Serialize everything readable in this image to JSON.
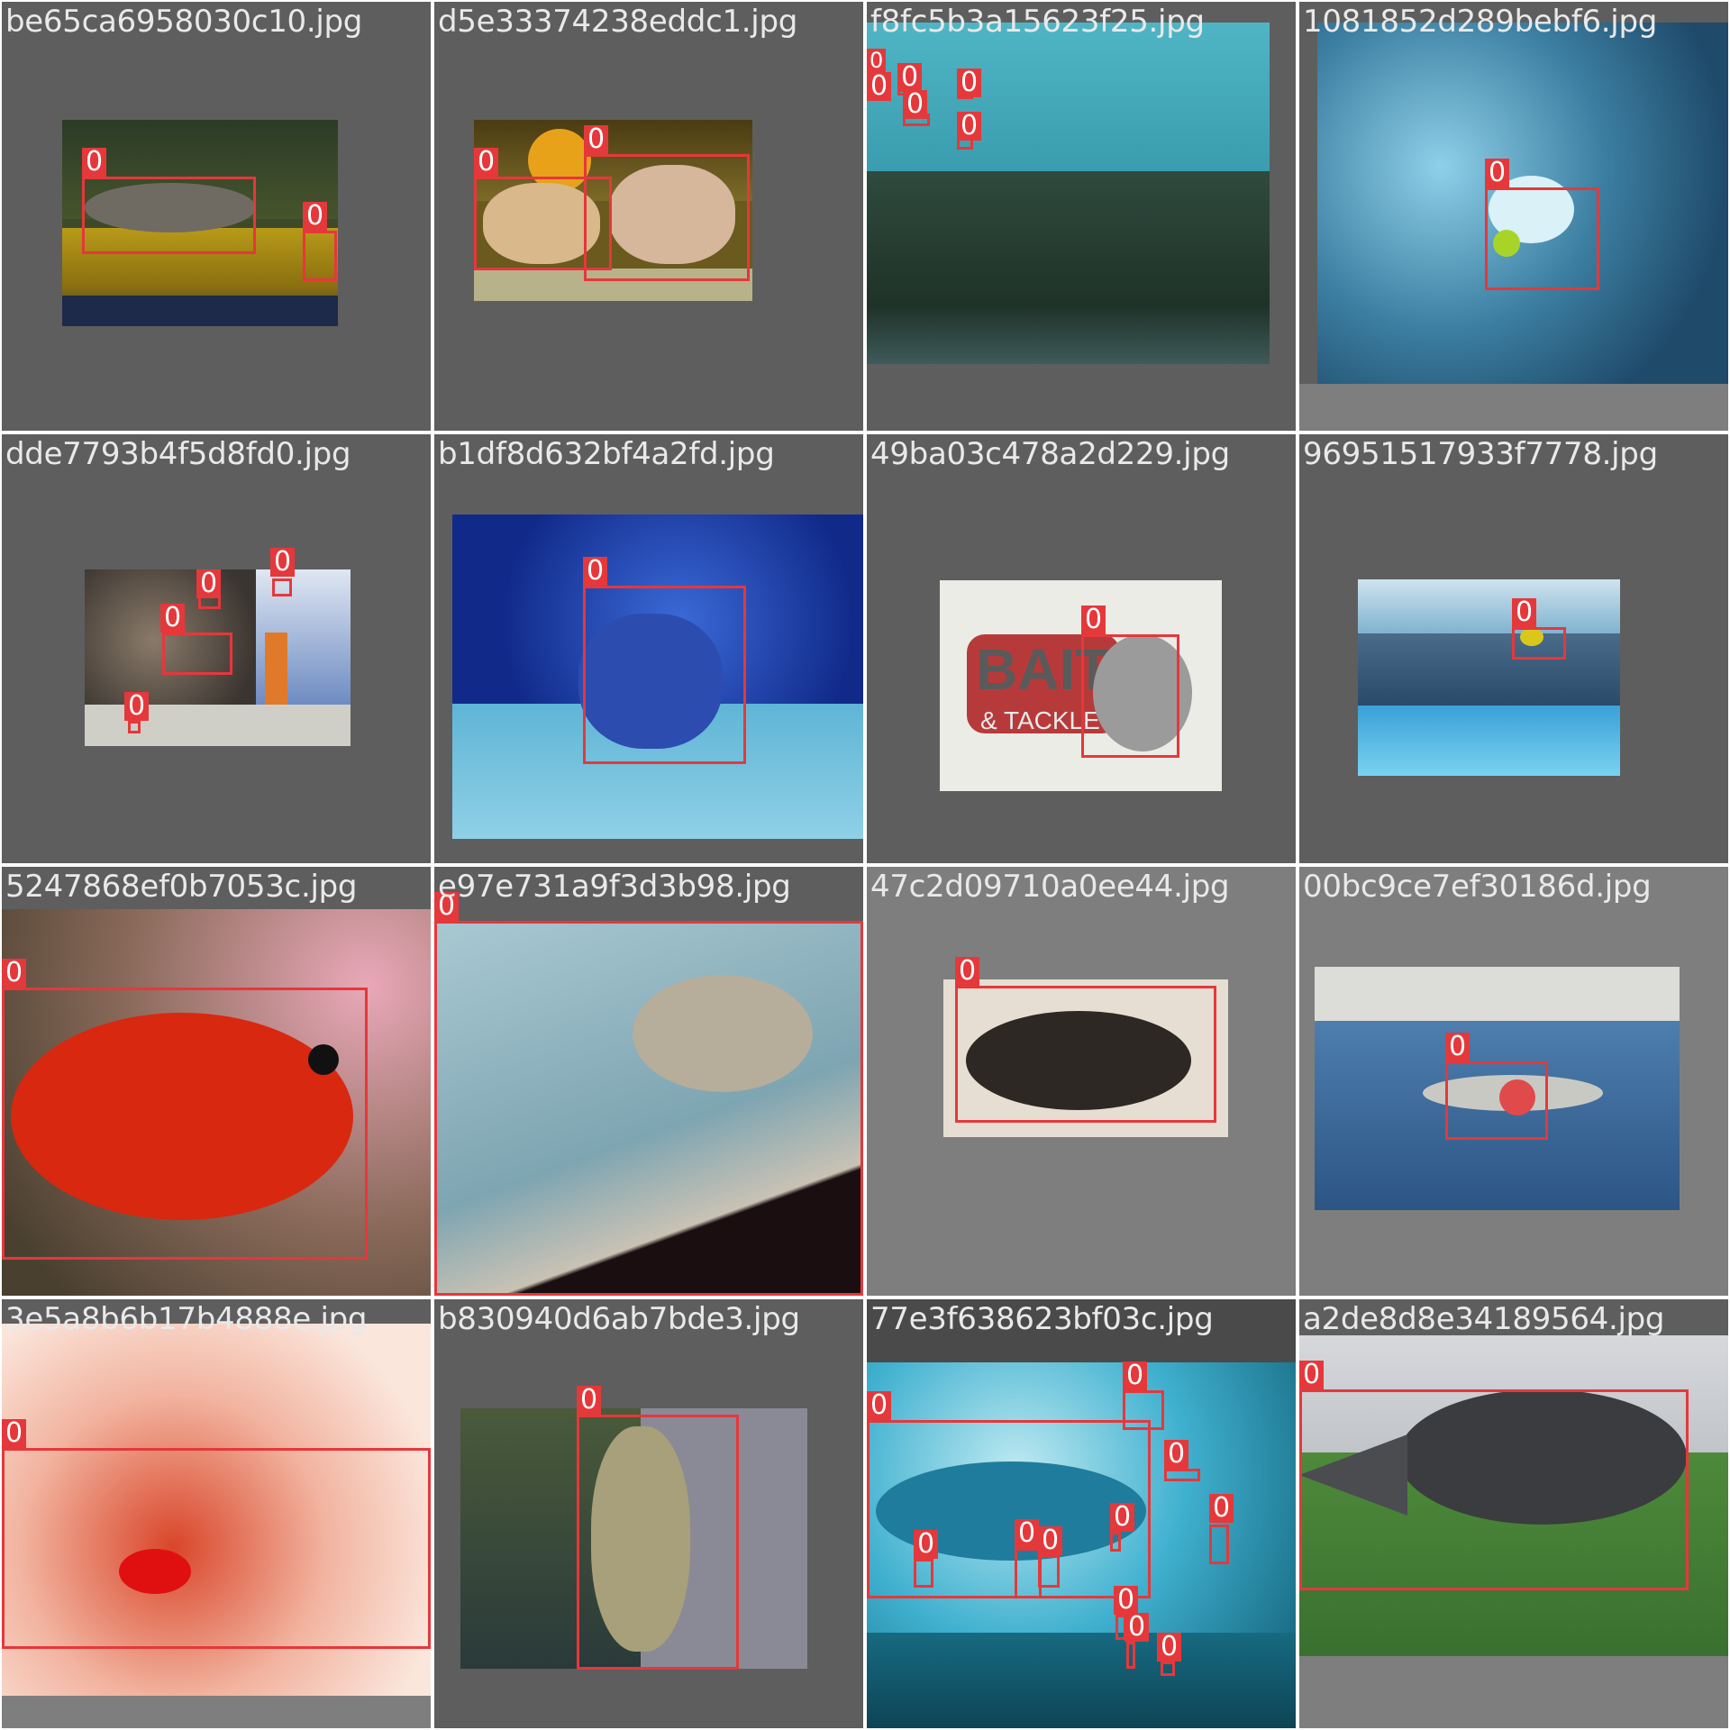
{
  "mosaic": {
    "tiles": [
      {
        "filename": "be65ca6958030c10.jpg",
        "labels": [
          "0",
          "0"
        ]
      },
      {
        "filename": "d5e33374238eddc1.jpg",
        "labels": [
          "0",
          "0"
        ]
      },
      {
        "filename": "f8fc5b3a15623f25.jpg",
        "labels": [
          "0",
          "0",
          "0",
          "0",
          "0",
          "0"
        ]
      },
      {
        "filename": "1081852d289bebf6.jpg",
        "labels": [
          "0"
        ]
      },
      {
        "filename": "dde7793b4f5d8fd0.jpg",
        "labels": [
          "0",
          "0",
          "0",
          "0"
        ]
      },
      {
        "filename": "b1df8d632bf4a2fd.jpg",
        "labels": [
          "0"
        ]
      },
      {
        "filename": "49ba03c478a2d229.jpg",
        "labels": [
          "0"
        ],
        "image_text": [
          "BAIT",
          "& TACKLE"
        ]
      },
      {
        "filename": "96951517933f7778.jpg",
        "labels": [
          "0"
        ]
      },
      {
        "filename": "5247868ef0b7053c.jpg",
        "labels": [
          "0"
        ]
      },
      {
        "filename": "e97e731a9f3d3b98.jpg",
        "labels": [
          "0"
        ]
      },
      {
        "filename": "47c2d09710a0ee44.jpg",
        "labels": [
          "0"
        ]
      },
      {
        "filename": "00bc9ce7ef30186d.jpg",
        "labels": [
          "0"
        ]
      },
      {
        "filename": "3e5a8b6b17b4888e.jpg",
        "labels": [
          "0"
        ]
      },
      {
        "filename": "b830940d6ab7bde3.jpg",
        "labels": [
          "0"
        ]
      },
      {
        "filename": "77e3f638623bf03c.jpg",
        "labels": [
          "0",
          "0",
          "0",
          "0",
          "0",
          "0",
          "0",
          "0",
          "0",
          "0"
        ]
      },
      {
        "filename": "a2de8d8e34189564.jpg",
        "labels": [
          "0"
        ]
      }
    ],
    "colors": {
      "box": "#e5383b",
      "label_text": "#ffffff",
      "filename_text": "#e9e9e9",
      "padding": "#5e5e5e"
    }
  }
}
